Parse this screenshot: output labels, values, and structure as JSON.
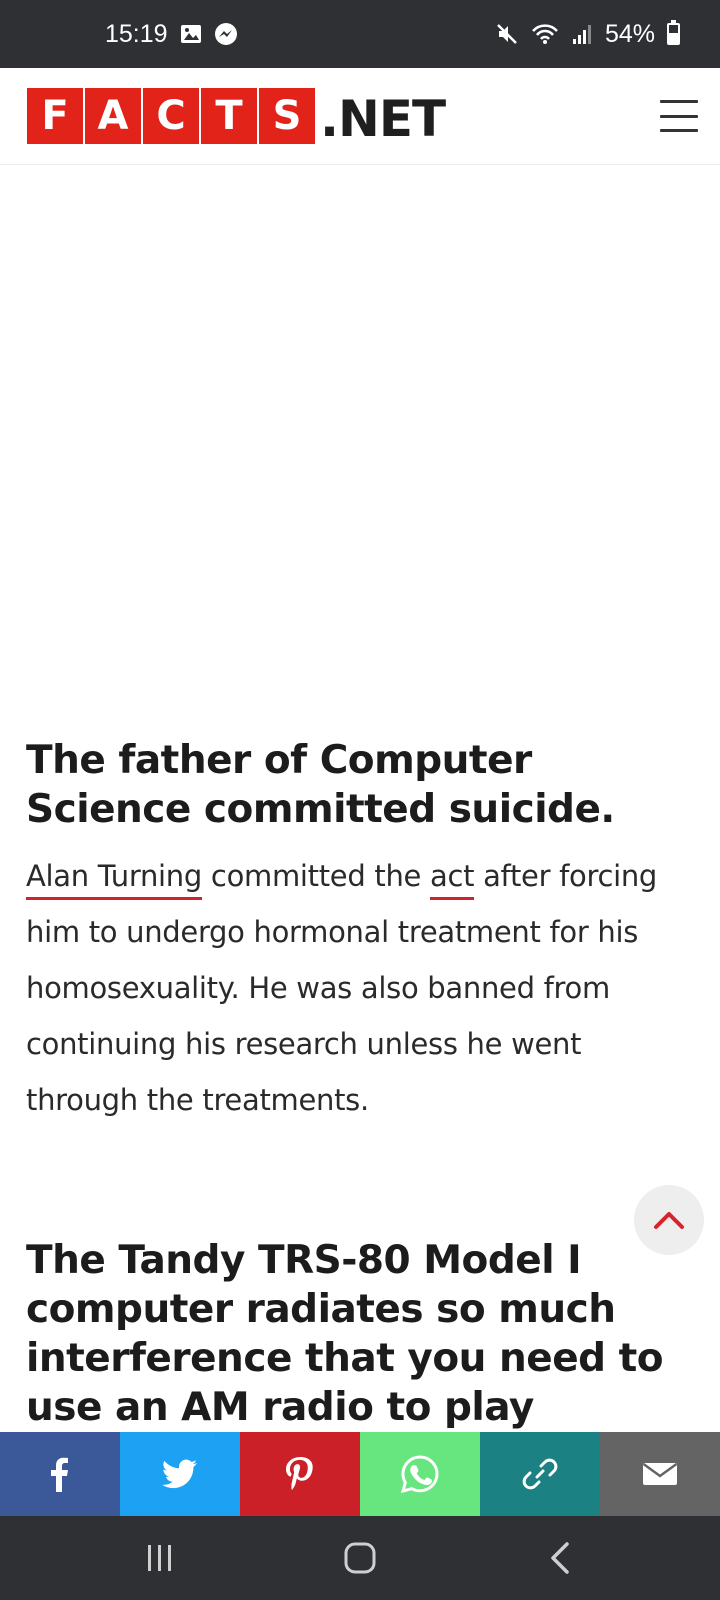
{
  "status_bar": {
    "time": "15:19",
    "battery": "54%",
    "icons": [
      "gallery-icon",
      "messenger-icon",
      "mute-icon",
      "wifi-icon",
      "signal-icon",
      "battery-icon"
    ]
  },
  "header": {
    "logo_letters": [
      "F",
      "A",
      "C",
      "T",
      "S"
    ],
    "logo_suffix": ".NET",
    "brand_color": "#e2231a"
  },
  "article": {
    "fact1_title": "The father of Computer Science committed suicide.",
    "fact1_link1": "Alan Turning",
    "fact1_text1": " committed the ",
    "fact1_link2": "act",
    "fact1_text2": " after forcing him to undergo hormonal treatment for his homosexuality. He was also banned from continuing his research unless he went through the treatments.",
    "fact2_title": "The Tandy TRS-80 Model I computer radiates so much interference that you need to use an AM radio to play sounds from"
  },
  "share_bar": [
    {
      "name": "facebook",
      "color": "#3b5998"
    },
    {
      "name": "twitter",
      "color": "#1da1f2"
    },
    {
      "name": "pinterest",
      "color": "#cb2027"
    },
    {
      "name": "whatsapp",
      "color": "#67e57e"
    },
    {
      "name": "copy-link",
      "color": "#1b8182"
    },
    {
      "name": "email",
      "color": "#646464"
    }
  ],
  "nav_bar": [
    "recents-icon",
    "home-icon",
    "back-icon"
  ]
}
